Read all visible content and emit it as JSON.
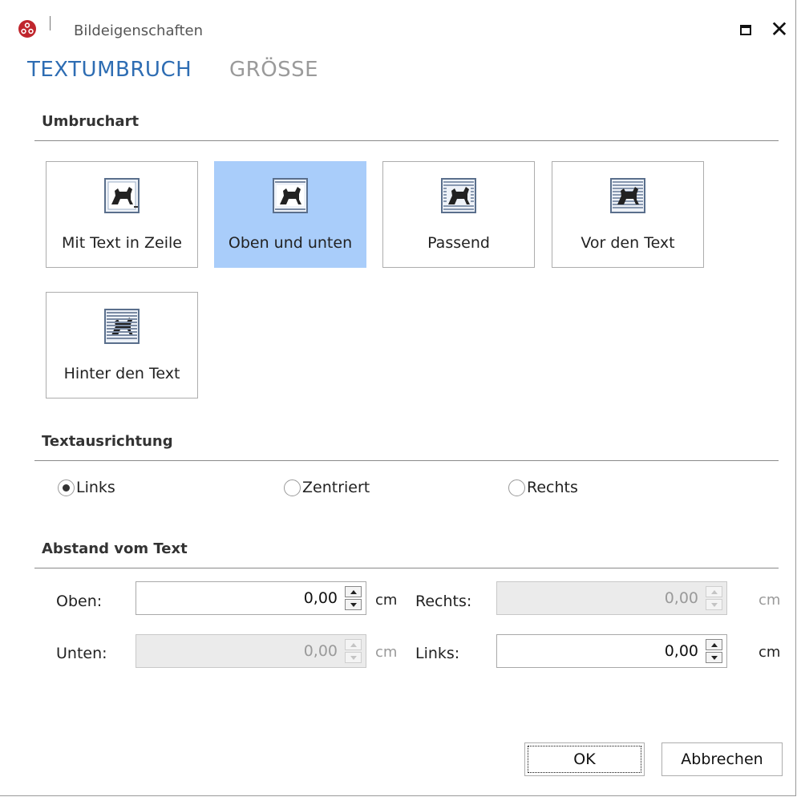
{
  "window": {
    "title": "Bildeigenschaften",
    "app_icon": "app-logo-icon",
    "maximize_icon": "maximize-icon",
    "close_icon": "close-icon",
    "close_glyph": "✕"
  },
  "tabs": [
    {
      "label": "TEXTUMBRUCH",
      "active": true
    },
    {
      "label": "GRÖSSE",
      "active": false
    }
  ],
  "sections": {
    "wrap_type": "Umbruchart",
    "text_alignment": "Textausrichtung",
    "distance": "Abstand vom Text"
  },
  "wrap_options": [
    {
      "label": "Mit Text in Zeile",
      "icon": "wrap-inline-icon",
      "selected": false
    },
    {
      "label": "Oben und unten",
      "icon": "wrap-top-bottom-icon",
      "selected": true
    },
    {
      "label": "Passend",
      "icon": "wrap-square-icon",
      "selected": false
    },
    {
      "label": "Vor den Text",
      "icon": "wrap-in-front-icon",
      "selected": false
    },
    {
      "label": "Hinter den Text",
      "icon": "wrap-behind-icon",
      "selected": false
    }
  ],
  "alignment": [
    {
      "label": "Links",
      "checked": true
    },
    {
      "label": "Zentriert",
      "checked": false
    },
    {
      "label": "Rechts",
      "checked": false
    }
  ],
  "distance": {
    "top": {
      "label": "Oben:",
      "value": "0,00",
      "unit": "cm",
      "enabled": true
    },
    "right": {
      "label": "Rechts:",
      "value": "0,00",
      "unit": "cm",
      "enabled": false
    },
    "bottom": {
      "label": "Unten:",
      "value": "0,00",
      "unit": "cm",
      "enabled": false
    },
    "left": {
      "label": "Links:",
      "value": "0,00",
      "unit": "cm",
      "enabled": true
    }
  },
  "buttons": {
    "ok": "OK",
    "cancel": "Abbrechen"
  },
  "colors": {
    "accent": "#2e6db3",
    "selected_bg": "#a9cdfa",
    "app_icon_red": "#c0262d"
  }
}
